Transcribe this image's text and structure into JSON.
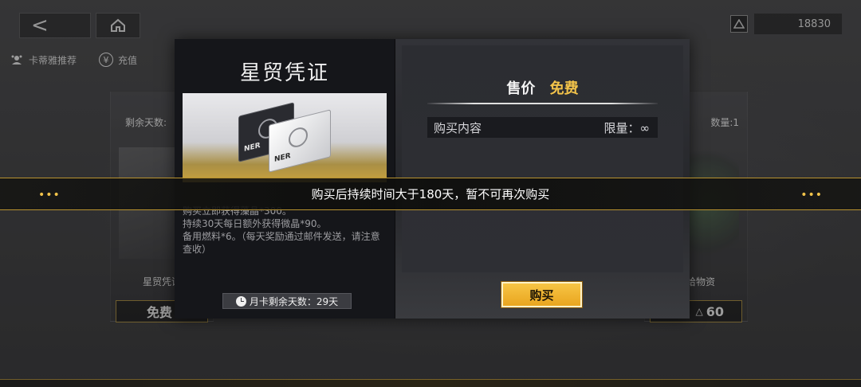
{
  "header": {
    "back_icon": "back-arrow-icon",
    "back_glyph": "<",
    "home_icon": "home-icon",
    "currency": {
      "icon": "crystal-icon",
      "value": "18830"
    }
  },
  "subnav": {
    "items": [
      {
        "label": "卡蒂雅推荐",
        "icon": "character-icon"
      },
      {
        "label": "充值",
        "icon": "yen-icon"
      }
    ]
  },
  "background_cards": {
    "left": {
      "days_label": "剩余天数:",
      "name": "星贸凭证",
      "price": "免费"
    },
    "right": {
      "count_label": "数量:1",
      "name": "补给物资",
      "price": "60"
    }
  },
  "modal": {
    "title": "星贸凭证",
    "item_image": "star-trade-voucher-cards",
    "card_logo": "NER",
    "description": [
      "购买立即获得藻晶*300。",
      "持续30天每日额外获得微晶*90。",
      "备用燃料*6。（每天奖励通过邮件发送，请注意查收）"
    ],
    "remaining_days_badge": "月卡剩余天数：29天",
    "price_label": "售价",
    "price_value": "免费",
    "content_label": "购买内容",
    "limit_label": "限量：∞",
    "buy_button": "购买",
    "accent_color": "#f2c34a"
  },
  "toast": {
    "message": "购买后持续时间大于180天，暂不可再次购买",
    "decoration_left": "•••",
    "decoration_right": "•••"
  }
}
